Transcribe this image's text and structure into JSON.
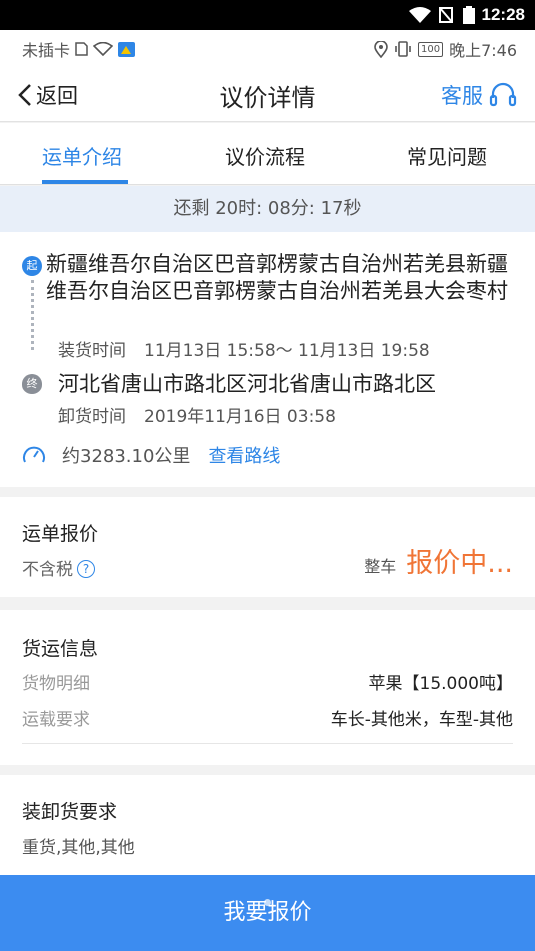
{
  "system": {
    "time": "12:28"
  },
  "status": {
    "sim": "未插卡",
    "battery": "100",
    "clock": "晚上7:46"
  },
  "nav": {
    "back_label": "返回",
    "title": "议价详情",
    "service_label": "客服"
  },
  "tabs": [
    {
      "label": "运单介绍",
      "active": true
    },
    {
      "label": "议价流程",
      "active": false
    },
    {
      "label": "常见问题",
      "active": false
    }
  ],
  "countdown": "还剩 20时: 08分: 17秒",
  "route": {
    "start_badge": "起",
    "start_address": "新疆维吾尔自治区巴音郭楞蒙古自治州若羌县新疆维吾尔自治区巴音郭楞蒙古自治州若羌县大会枣村",
    "load_label": "装货时间",
    "load_time": "11月13日 15:58～ 11月13日 19:58",
    "end_badge": "终",
    "end_address": "河北省唐山市路北区河北省唐山市路北区",
    "unload_label": "卸货时间",
    "unload_time": "2019年11月16日 03:58",
    "distance": "约3283.10公里",
    "view_route": "查看路线"
  },
  "quote": {
    "title": "运单报价",
    "tax_note": "不含税",
    "help": "?",
    "type": "整车",
    "state": "报价中..."
  },
  "cargo": {
    "title": "货运信息",
    "detail_label": "货物明细",
    "detail_value": "苹果【15.000吨】",
    "req_label": "运载要求",
    "req_value": "车长-其他米，车型-其他"
  },
  "handling": {
    "title": "装卸货要求",
    "value": "重货,其他,其他"
  },
  "bottom_button": "我要报价",
  "colors": {
    "accent": "#2e86e6",
    "quoting": "#f07536",
    "button": "#3c8cf0"
  }
}
